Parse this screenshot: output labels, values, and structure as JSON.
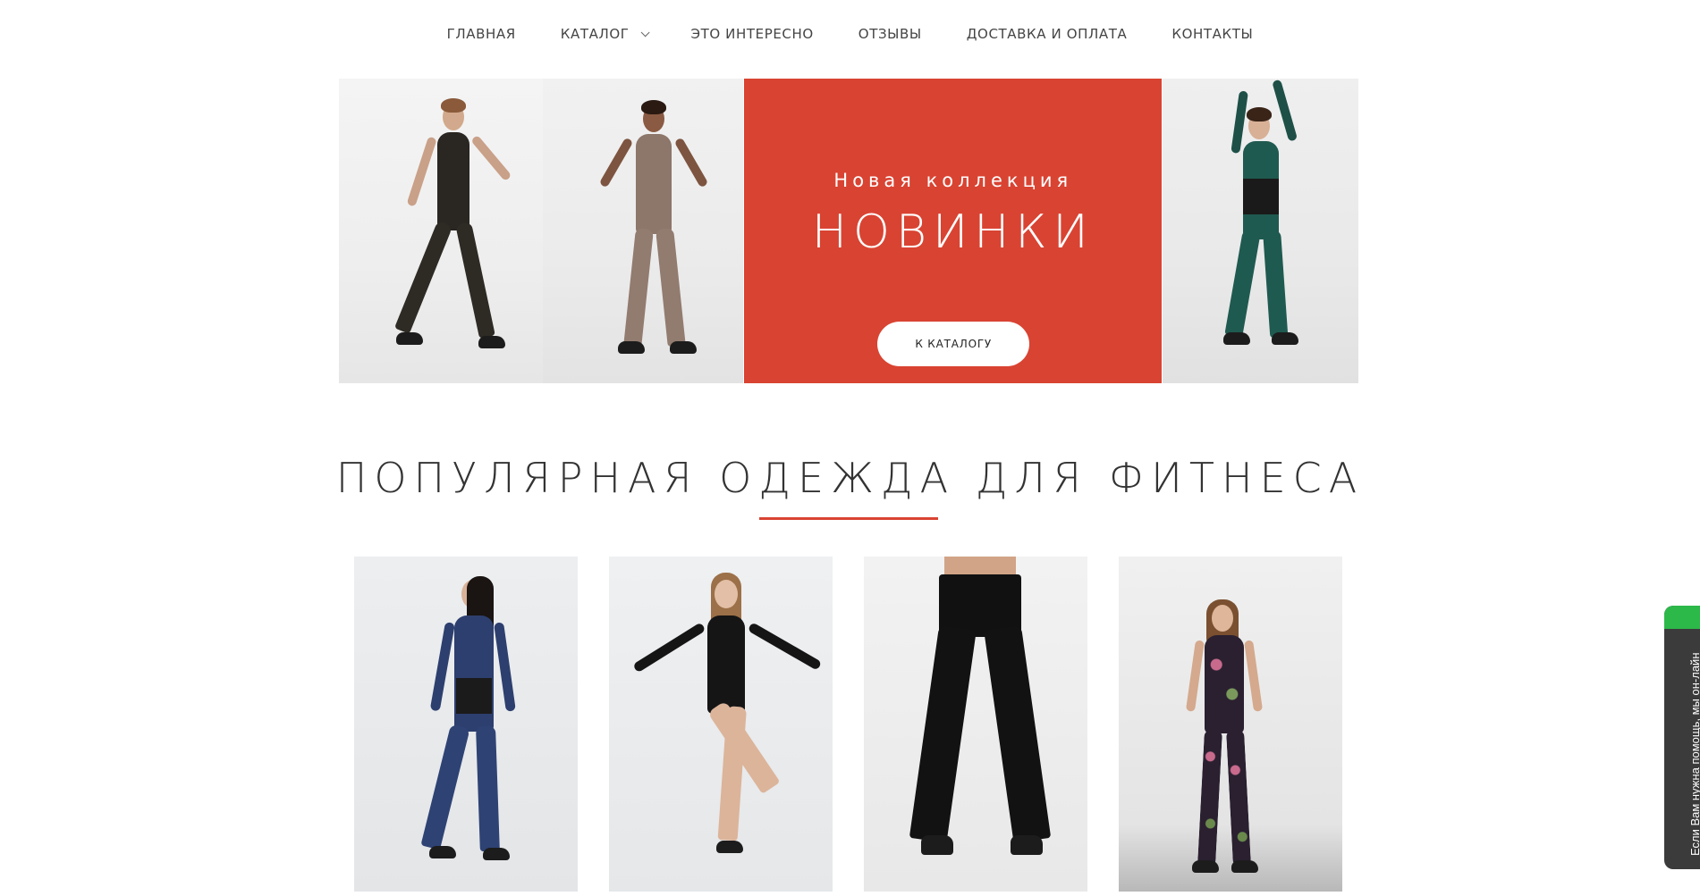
{
  "nav": {
    "items": [
      {
        "label": "ГЛАВНАЯ"
      },
      {
        "label": "КАТАЛОГ"
      },
      {
        "label": "ЭТО ИНТЕРЕСНО"
      },
      {
        "label": "ОТЗЫВЫ"
      },
      {
        "label": "ДОСТАВКА И ОПЛАТА"
      },
      {
        "label": "КОНТАКТЫ"
      }
    ]
  },
  "hero": {
    "subtitle": "Новая коллекция",
    "title": "НОВИНКИ",
    "button_label": "К КАТАЛОГУ",
    "accent_color": "#d94332"
  },
  "section": {
    "title": "ПОПУЛЯРНАЯ ОДЕЖДА ДЛЯ ФИТНЕСА"
  },
  "chat": {
    "text": "Если Вам нужна помощь, мы он-лайн",
    "status_color": "#2db84a"
  },
  "icons": {
    "catalog_dropdown": "chevron-down-icon"
  }
}
